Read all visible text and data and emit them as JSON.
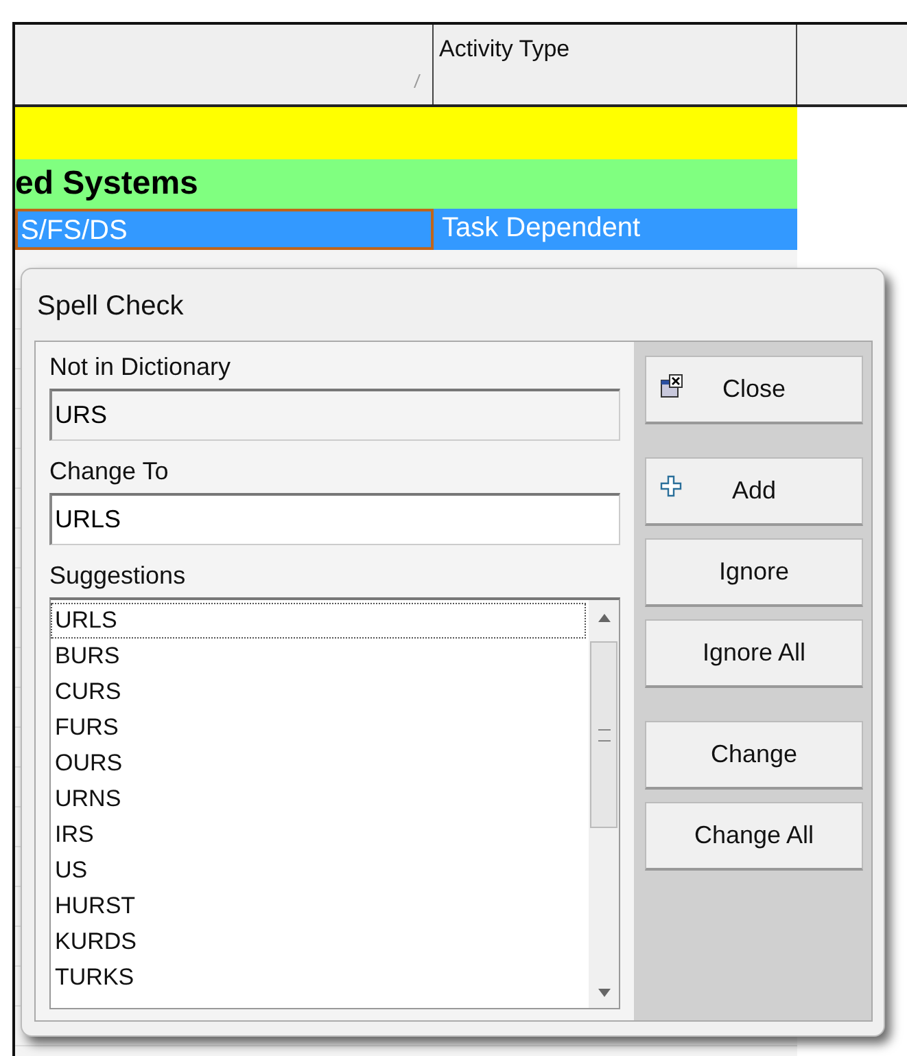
{
  "grid": {
    "columns": [
      {
        "sorted": true
      },
      {
        "label": "Activity Type",
        "sorted": false
      }
    ],
    "rows": [
      {
        "kind": "band",
        "color": "#ffff00"
      },
      {
        "kind": "group",
        "color": "#80ff80",
        "text": "ed Systems"
      },
      {
        "kind": "data",
        "selected": true,
        "cells": [
          "S/FS/DS",
          "Task Dependent"
        ]
      }
    ]
  },
  "dialog": {
    "title": "Spell Check",
    "not_in_dictionary": {
      "label": "Not in Dictionary",
      "value": "URS"
    },
    "change_to": {
      "label": "Change To",
      "value": "URLS"
    },
    "suggestions": {
      "label": "Suggestions",
      "items": [
        {
          "text": "URLS",
          "selected": true
        },
        {
          "text": "BURS",
          "selected": false
        },
        {
          "text": "CURS",
          "selected": false
        },
        {
          "text": "FURS",
          "selected": false
        },
        {
          "text": "OURS",
          "selected": false
        },
        {
          "text": "URNS",
          "selected": false
        },
        {
          "text": "IRS",
          "selected": false
        },
        {
          "text": "US",
          "selected": false
        },
        {
          "text": "HURST",
          "selected": false
        },
        {
          "text": "KURDS",
          "selected": false
        },
        {
          "text": "TURKS",
          "selected": false
        }
      ]
    },
    "button_groups": [
      [
        {
          "label": "Close",
          "kind": "close"
        }
      ],
      [
        {
          "label": "Add",
          "kind": "add"
        },
        {
          "label": "Ignore",
          "kind": "plain"
        },
        {
          "label": "Ignore All",
          "kind": "plain"
        }
      ],
      [
        {
          "label": "Change",
          "kind": "plain"
        },
        {
          "label": "Change All",
          "kind": "plain"
        }
      ]
    ]
  }
}
